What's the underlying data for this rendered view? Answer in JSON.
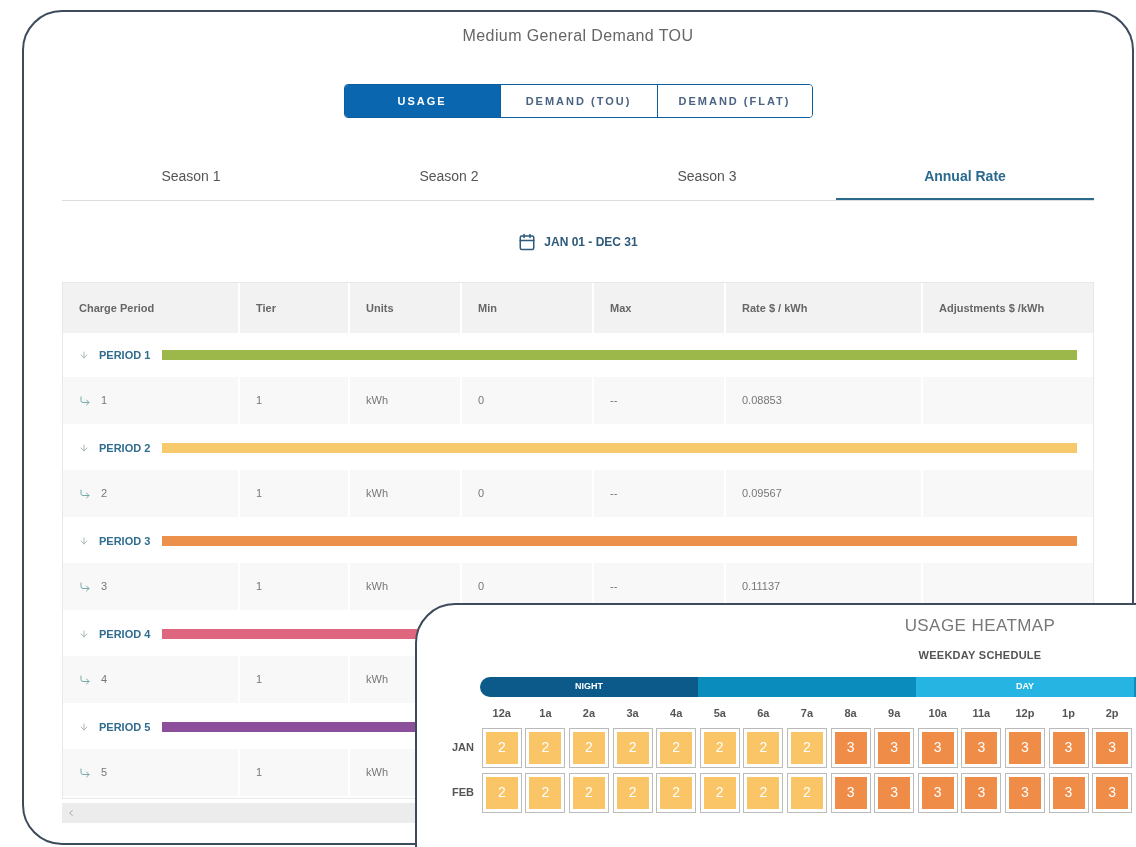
{
  "title": "Medium General Demand TOU",
  "segments": [
    {
      "label": "USAGE",
      "selected": true
    },
    {
      "label": "DEMAND (TOU)",
      "selected": false
    },
    {
      "label": "DEMAND (FLAT)",
      "selected": false
    }
  ],
  "tabs": [
    {
      "label": "Season 1",
      "selected": false
    },
    {
      "label": "Season 2",
      "selected": false
    },
    {
      "label": "Season 3",
      "selected": false
    },
    {
      "label": "Annual Rate",
      "selected": true
    }
  ],
  "date_range": "JAN 01 - DEC 31",
  "table": {
    "columns": [
      "Charge Period",
      "Tier",
      "Units",
      "Min",
      "Max",
      "Rate $ / kWh",
      "Adjustments $ /kWh"
    ],
    "periods": [
      {
        "label": "PERIOD 1",
        "color": "#9cb84a",
        "tiers": [
          {
            "period": "1",
            "tier": "1",
            "units": "kWh",
            "min": "0",
            "max": "--",
            "rate": "0.08853"
          }
        ]
      },
      {
        "label": "PERIOD 2",
        "color": "#f7c96c",
        "tiers": [
          {
            "period": "2",
            "tier": "1",
            "units": "kWh",
            "min": "0",
            "max": "--",
            "rate": "0.09567"
          }
        ]
      },
      {
        "label": "PERIOD 3",
        "color": "#ec914c",
        "tiers": [
          {
            "period": "3",
            "tier": "1",
            "units": "kWh",
            "min": "0",
            "max": "--",
            "rate": "0.11137"
          }
        ]
      },
      {
        "label": "PERIOD 4",
        "color": "#df667f",
        "tiers": [
          {
            "period": "4",
            "tier": "1",
            "units": "kWh"
          }
        ]
      },
      {
        "label": "PERIOD 5",
        "color": "#8c4f9c",
        "tiers": [
          {
            "period": "5",
            "tier": "1",
            "units": "kWh"
          }
        ]
      }
    ]
  },
  "heatmap": {
    "title": "USAGE HEATMAP",
    "subtitle": "WEEKDAY SCHEDULE",
    "bands": [
      {
        "label": "NIGHT",
        "color": "#0b5a8a"
      },
      {
        "color": "#0a8dbd"
      },
      {
        "label": "DAY",
        "color": "#26b5e2"
      },
      {
        "color": "#0a8dbd"
      }
    ],
    "hours": [
      "12a",
      "1a",
      "2a",
      "3a",
      "4a",
      "5a",
      "6a",
      "7a",
      "8a",
      "9a",
      "10a",
      "11a",
      "12p",
      "1p",
      "2p"
    ],
    "rows": [
      {
        "month": "JAN",
        "cells": [
          {
            "value": "2",
            "color": "#f9c566"
          },
          {
            "value": "2",
            "color": "#f9c566"
          },
          {
            "value": "2",
            "color": "#f9c566"
          },
          {
            "value": "2",
            "color": "#f9c566"
          },
          {
            "value": "2",
            "color": "#f9c566"
          },
          {
            "value": "2",
            "color": "#f9c566"
          },
          {
            "value": "2",
            "color": "#f9c566"
          },
          {
            "value": "2",
            "color": "#f9c566"
          },
          {
            "value": "3",
            "color": "#ef8c48"
          },
          {
            "value": "3",
            "color": "#ef8c48"
          },
          {
            "value": "3",
            "color": "#ef8c48"
          },
          {
            "value": "3",
            "color": "#ef8c48"
          },
          {
            "value": "3",
            "color": "#ef8c48"
          },
          {
            "value": "3",
            "color": "#ef8c48"
          },
          {
            "value": "3",
            "color": "#ef8c48"
          }
        ]
      },
      {
        "month": "FEB",
        "cells": [
          {
            "value": "2",
            "color": "#f9c566"
          },
          {
            "value": "2",
            "color": "#f9c566"
          },
          {
            "value": "2",
            "color": "#f9c566"
          },
          {
            "value": "2",
            "color": "#f9c566"
          },
          {
            "value": "2",
            "color": "#f9c566"
          },
          {
            "value": "2",
            "color": "#f9c566"
          },
          {
            "value": "2",
            "color": "#f9c566"
          },
          {
            "value": "2",
            "color": "#f9c566"
          },
          {
            "value": "3",
            "color": "#ef8c48"
          },
          {
            "value": "3",
            "color": "#ef8c48"
          },
          {
            "value": "3",
            "color": "#ef8c48"
          },
          {
            "value": "3",
            "color": "#ef8c48"
          },
          {
            "value": "3",
            "color": "#ef8c48"
          },
          {
            "value": "3",
            "color": "#ef8c48"
          },
          {
            "value": "3",
            "color": "#ef8c48"
          }
        ]
      }
    ]
  }
}
